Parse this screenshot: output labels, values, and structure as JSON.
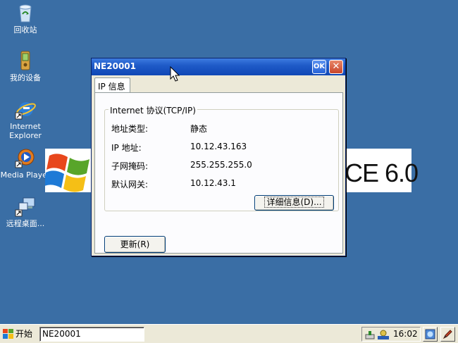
{
  "desktop": {
    "icons": [
      {
        "label": "回收站",
        "icon": "recycle-bin-icon"
      },
      {
        "label": "我的设备",
        "icon": "my-device-icon"
      },
      {
        "label": "Internet Explorer",
        "icon": "internet-explorer-icon"
      },
      {
        "label": "Media Player",
        "icon": "media-player-icon"
      },
      {
        "label": "远程桌面...",
        "icon": "remote-desktop-icon"
      }
    ],
    "background_text": "CE 6.0"
  },
  "dialog": {
    "title": "NE20001",
    "ok_label": "OK",
    "close_label": "✕",
    "tab_label": "IP 信息",
    "group_title": "Internet 协议(TCP/IP)",
    "rows": [
      {
        "label": "地址类型:",
        "value": "静态"
      },
      {
        "label": "IP 地址:",
        "value": "10.12.43.163"
      },
      {
        "label": "子网掩码:",
        "value": "255.255.255.0"
      },
      {
        "label": "默认网关:",
        "value": "10.12.43.1"
      }
    ],
    "details_button": "详细信息(D)...",
    "refresh_button": "更新(R)"
  },
  "taskbar": {
    "start_label": "开始",
    "task_item": "NE20001",
    "clock": "16:02"
  },
  "colors": {
    "desktop": "#3a6ea5",
    "titlebar": "#1f5bc8",
    "dialog_bg": "#ece9d8"
  }
}
